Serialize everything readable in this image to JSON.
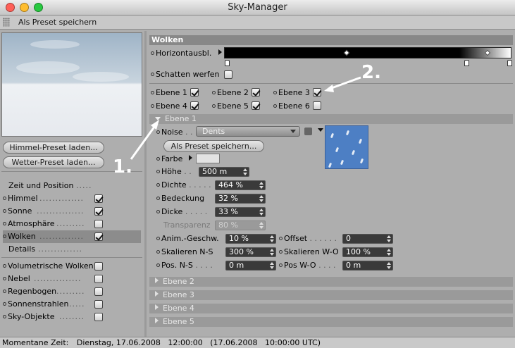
{
  "window": {
    "title": "Sky-Manager",
    "traffic_lights": [
      "#ff5f57",
      "#ffbd2e",
      "#28c940"
    ]
  },
  "toolbar": {
    "save_preset": "Als Preset speichern"
  },
  "left": {
    "load_sky_preset": "Himmel-Preset laden...",
    "load_weather_preset": "Wetter-Preset laden...",
    "items": [
      {
        "label": "Zeit und Position",
        "checked": null
      },
      {
        "label": "Himmel",
        "checked": true
      },
      {
        "label": "Sonne",
        "checked": true
      },
      {
        "label": "Atmosphäre",
        "checked": false
      },
      {
        "label": "Wolken",
        "checked": true
      },
      {
        "label": "Details",
        "checked": null
      },
      {
        "label": "Volumetrische Wolken",
        "checked": false
      },
      {
        "label": "Nebel",
        "checked": false
      },
      {
        "label": "Regenbogen",
        "checked": false
      },
      {
        "label": "Sonnenstrahlen",
        "checked": false
      },
      {
        "label": "Sky-Objekte",
        "checked": false
      }
    ]
  },
  "main": {
    "section_title": "Wolken",
    "horizon_label": "Horizontausbl.",
    "shadows_label": "Schatten werfen",
    "layers": [
      {
        "label": "Ebene 1",
        "checked": true
      },
      {
        "label": "Ebene 2",
        "checked": true
      },
      {
        "label": "Ebene 3",
        "checked": true
      },
      {
        "label": "Ebene 4",
        "checked": true
      },
      {
        "label": "Ebene 5",
        "checked": true
      },
      {
        "label": "Ebene 6",
        "checked": false
      }
    ],
    "layer1": {
      "header": "Ebene 1",
      "noise_label": "Noise",
      "noise_value": "Dents",
      "save_preset": "Als Preset speichern...",
      "color_label": "Farbe",
      "height_label": "Höhe",
      "height_value": "500 m",
      "density_label": "Dichte",
      "density_value": "464 %",
      "coverage_label": "Bedeckung",
      "coverage_value": "32 %",
      "thickness_label": "Dicke",
      "thickness_value": "33 %",
      "transparency_label": "Transparenz",
      "transparency_value": "80 %",
      "anim_label": "Anim.-Geschw.",
      "anim_value": "10 %",
      "offset_label": "Offset",
      "offset_value": "0",
      "scale_ns_label": "Skalieren N-S",
      "scale_ns_value": "300 %",
      "scale_wo_label": "Skalieren W-O",
      "scale_wo_value": "100 %",
      "pos_ns_label": "Pos. N-S",
      "pos_ns_value": "0 m",
      "pos_wo_label": "Pos W-O",
      "pos_wo_value": "0 m"
    },
    "collapsed_layers": [
      "Ebene 2",
      "Ebene 3",
      "Ebene 4",
      "Ebene 5"
    ]
  },
  "annotations": {
    "one": "1.",
    "two": "2."
  },
  "status": {
    "label": "Momentane Zeit:",
    "value": "Dienstag, 17.06.2008   12:00:00   (17.06.2008   10:00:00 UTC)"
  }
}
